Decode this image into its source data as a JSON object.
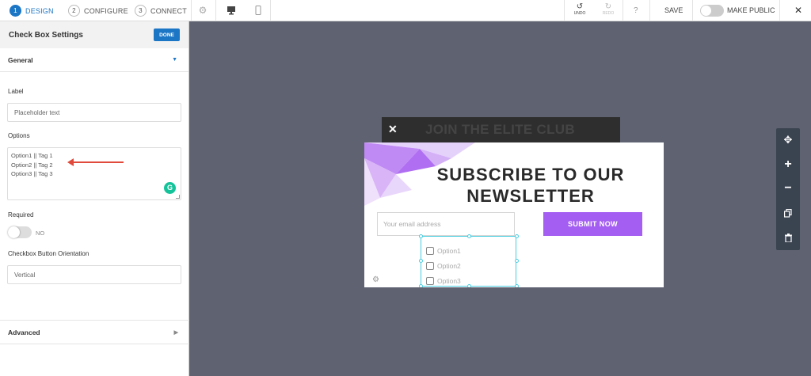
{
  "topbar": {
    "steps": [
      {
        "num": "1",
        "label": "DESIGN"
      },
      {
        "num": "2",
        "label": "CONFIGURE"
      },
      {
        "num": "3",
        "label": "CONNECT"
      }
    ],
    "undo_label": "UNDO",
    "redo_label": "REDO",
    "help": "?",
    "save_label": "SAVE",
    "make_public_label": "MAKE PUBLIC",
    "close": "✕"
  },
  "panel": {
    "title": "Check Box Settings",
    "done_label": "DONE",
    "general_label": "General",
    "label_field": {
      "label": "Label",
      "value": "Placeholder text"
    },
    "options_field": {
      "label": "Options",
      "lines": [
        "Option1 || Tag 1",
        "Option2 || Tag 2",
        "Option3 || Tag 3"
      ]
    },
    "required": {
      "label": "Required",
      "value": "NO"
    },
    "orientation": {
      "label": "Checkbox Button Orientation",
      "value": "Vertical"
    },
    "advanced_label": "Advanced"
  },
  "canvas": {
    "back_title": "JOIN THE ELITE CLUB",
    "headline_1": "SUBSCRIBE TO OUR",
    "headline_2": "NEWSLETTER",
    "email_placeholder": "Your email address",
    "submit_label": "SUBMIT NOW",
    "options": [
      "Option1",
      "Option2",
      "Option3"
    ]
  },
  "colors": {
    "accent": "#1c76c6",
    "submit": "#a45ef1",
    "selection": "#48cde0",
    "canvas_bg": "#5f6271"
  }
}
